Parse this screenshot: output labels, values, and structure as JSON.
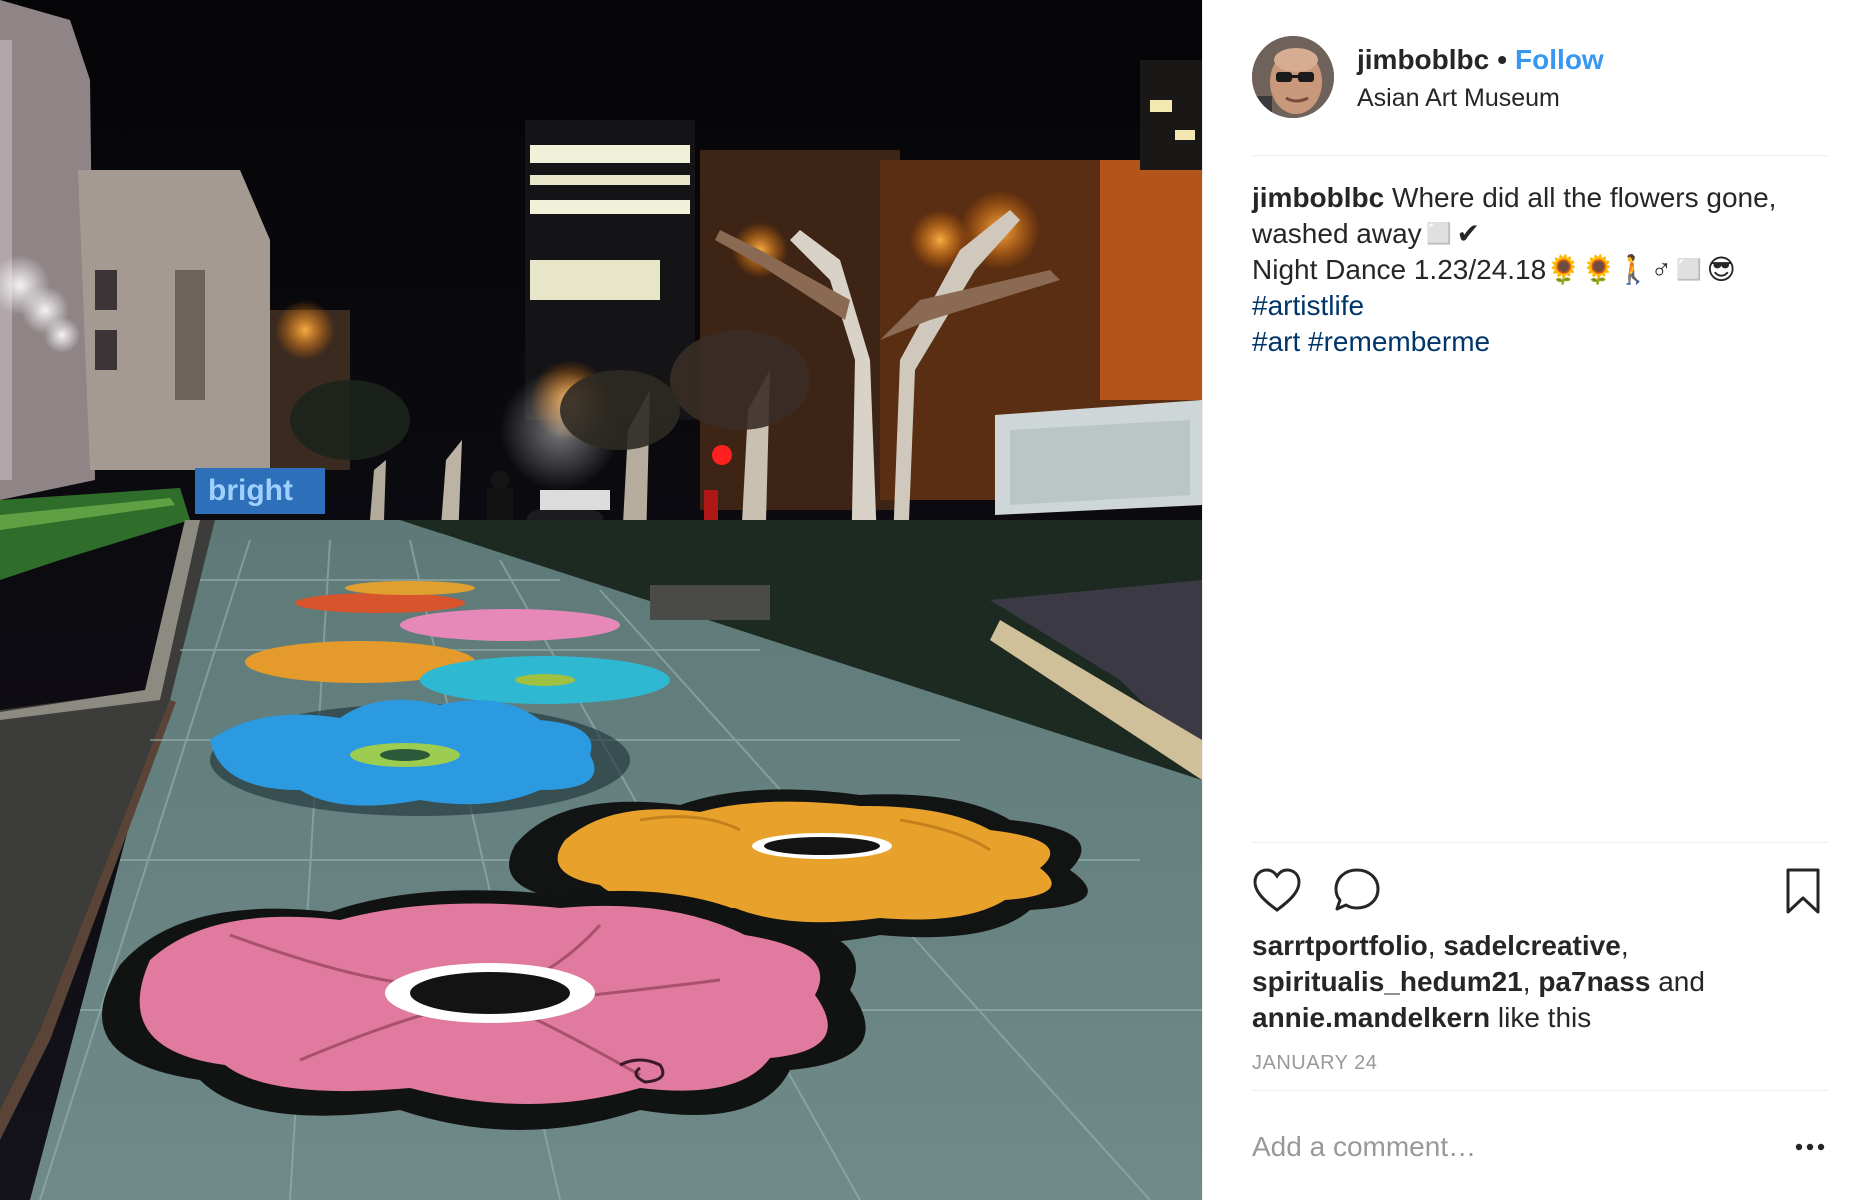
{
  "post": {
    "photo_alt": "Night photo of a plaza sidewalk painted with large colorful flowers",
    "photo_sign_text": "bright"
  },
  "header": {
    "username": "jimboblbc",
    "separator": "•",
    "follow_label": "Follow",
    "location": "Asian Art Museum",
    "follow_color": "#3897f0"
  },
  "caption": {
    "username": "jimboblbc",
    "text_line1": "Where did all the flowers gone,",
    "text_line2": "washed away◻️✔",
    "text_line3": "Night Dance 1.23/24.18🌻🌻🚶♂◻️😎",
    "hashtags": [
      "#artistlife",
      "#art",
      "#rememberme"
    ],
    "hashtag_color": "#003569"
  },
  "actions": {
    "like_icon": "heart-outline-icon",
    "comment_icon": "speech-bubble-icon",
    "save_icon": "bookmark-icon"
  },
  "likes": {
    "users": [
      "sarrtportfolio",
      "sadelcreative",
      "spiritualis_hedum21",
      "pa7nass",
      "annie.mandelkern"
    ],
    "and_word": "and",
    "suffix": "like this"
  },
  "date": "JANUARY 24",
  "comment": {
    "placeholder": "Add a comment…",
    "more_icon": "ellipsis-icon"
  }
}
